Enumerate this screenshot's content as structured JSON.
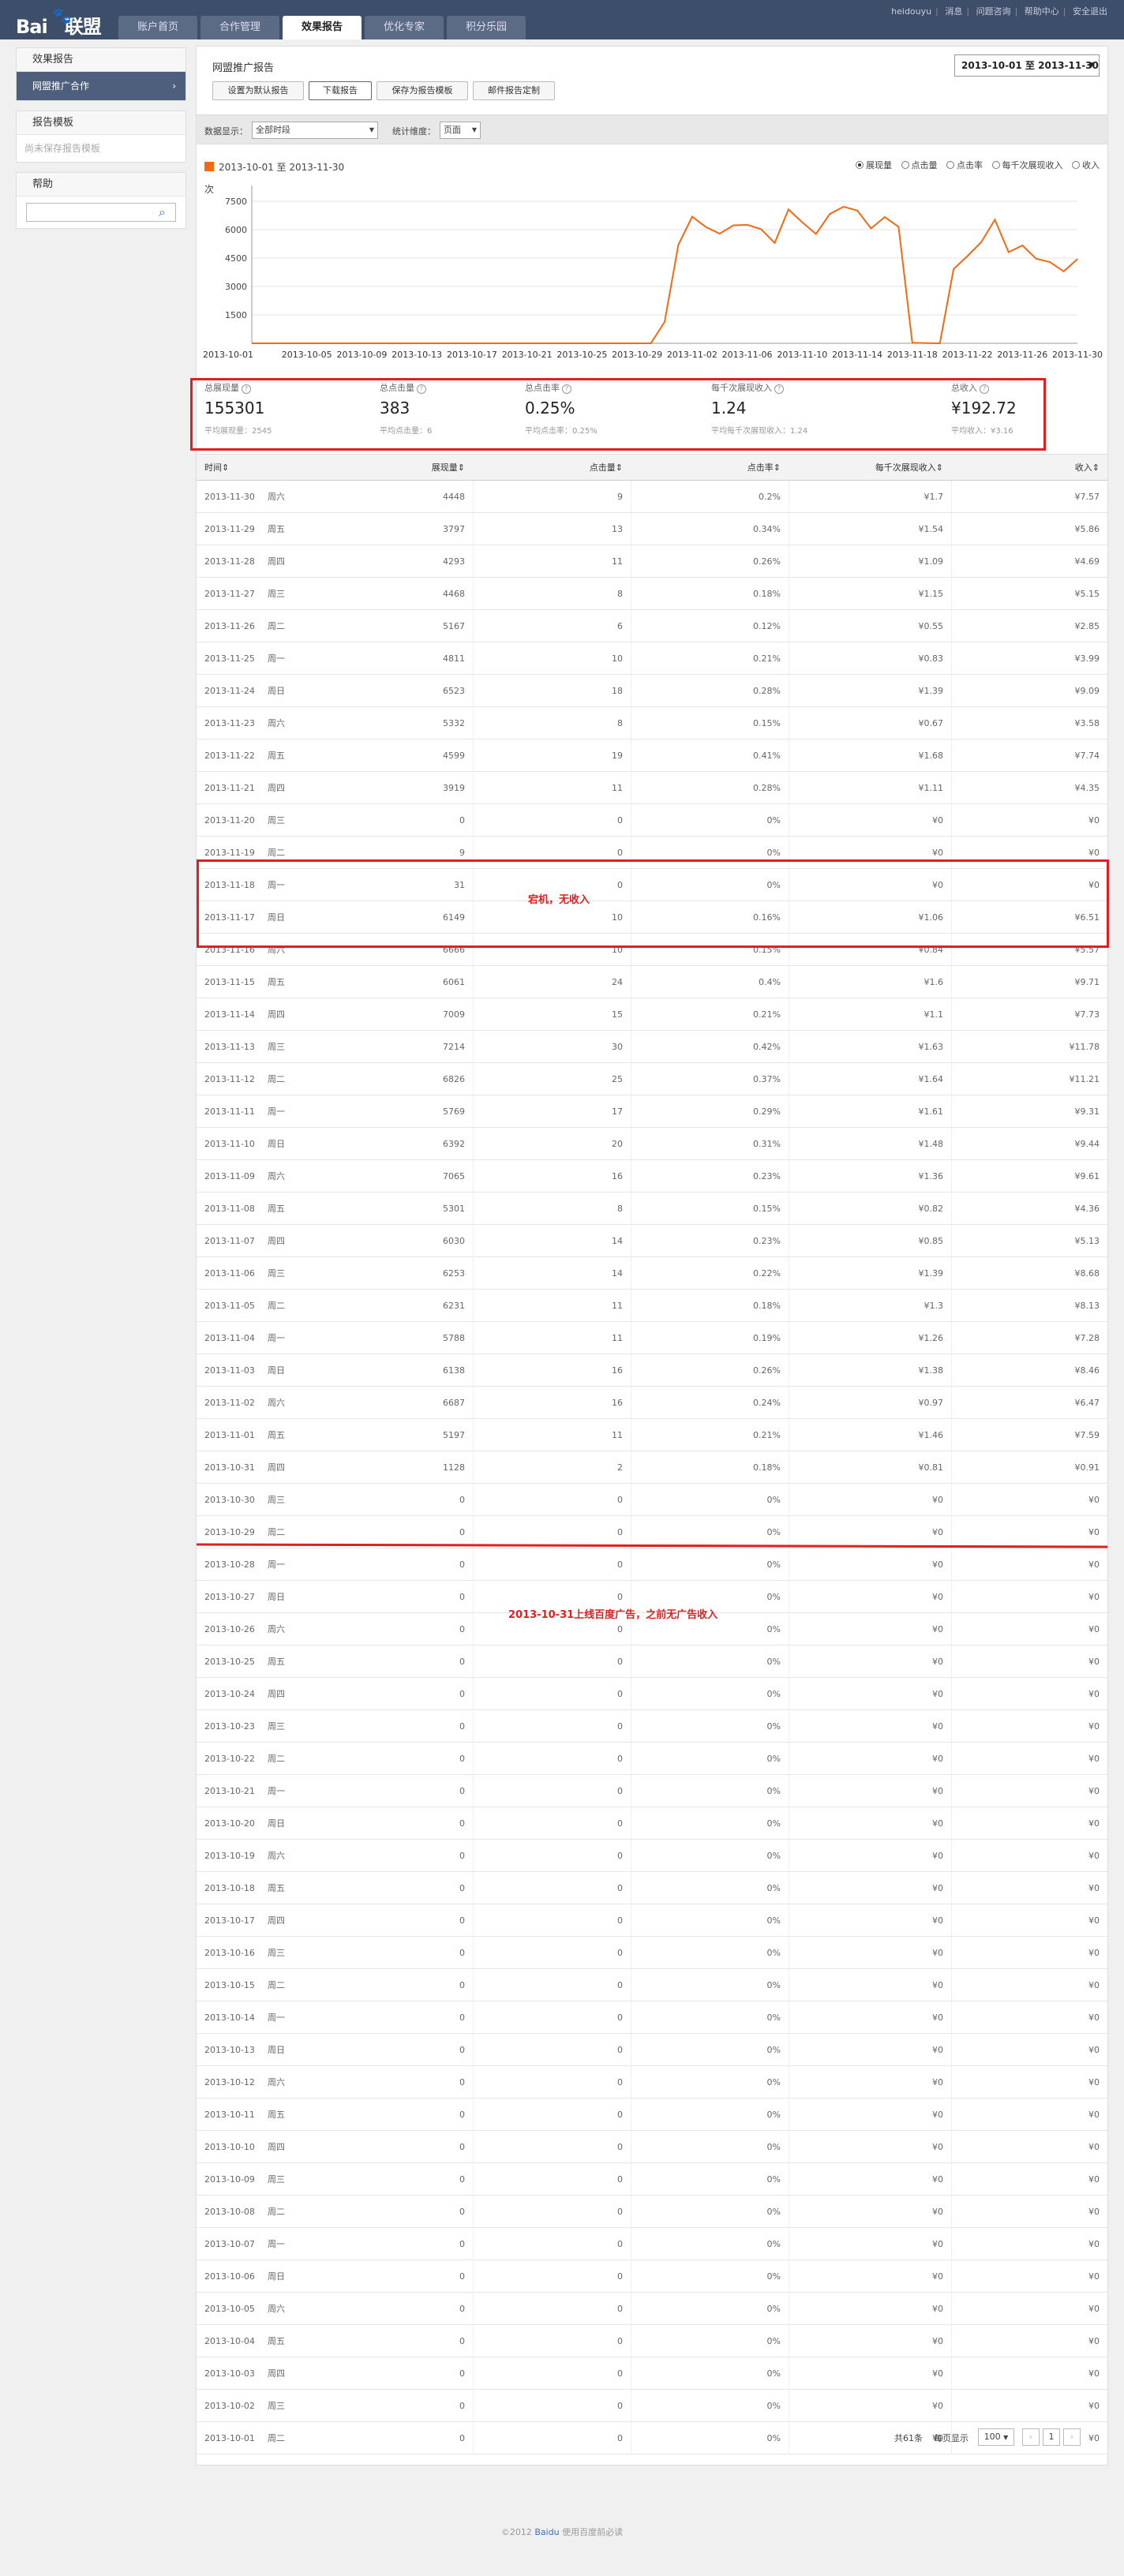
{
  "logo": {
    "text": "Bai",
    "paw": "🐾",
    "suffix": "联盟"
  },
  "nav": [
    "账户首页",
    "合作管理",
    "效果报告",
    "优化专家",
    "积分乐园"
  ],
  "toplinks": {
    "user": "heidouyu",
    "links": [
      "消息",
      "问题咨询",
      "帮助中心",
      "安全退出"
    ]
  },
  "sidebar": {
    "effect_title": "效果报告",
    "effect_item": "网盟推广合作",
    "effect_arrow": "›",
    "template_title": "报告模板",
    "template_empty": "尚未保存报告模板",
    "help_title": "帮助"
  },
  "report": {
    "title": "网盟推广报告",
    "buttons": [
      "设置为默认报告",
      "下载报告",
      "保存为报告模板",
      "邮件报告定制"
    ],
    "date_range": "2013-10-01 至 2013-11-30",
    "filter_label": "数据显示：",
    "filter_value": "全部时段",
    "dim_label": "统计维度：",
    "dim_value": "页面"
  },
  "chart_legend": "2013-10-01 至 2013-11-30",
  "metric_radios": [
    {
      "label": "展现量",
      "checked": true
    },
    {
      "label": "点击量",
      "checked": false
    },
    {
      "label": "点击率",
      "checked": false
    },
    {
      "label": "每千次展现收入",
      "checked": false
    },
    {
      "label": "收入",
      "checked": false
    }
  ],
  "chart_data": {
    "type": "line",
    "ylabel": "次",
    "ylim": [
      0,
      8000
    ],
    "yticks": [
      1500,
      3000,
      4500,
      6000,
      7500
    ],
    "xtick_labels": [
      "2013-10-01",
      "2013-10-05",
      "2013-10-09",
      "2013-10-13",
      "2013-10-17",
      "2013-10-21",
      "2013-10-25",
      "2013-10-29",
      "2013-11-02",
      "2013-11-06",
      "2013-11-10",
      "2013-11-14",
      "2013-11-18",
      "2013-11-22",
      "2013-11-26",
      "2013-11-30"
    ],
    "color": "#f26b13",
    "x": [
      "2013-10-01",
      "2013-10-02",
      "2013-10-03",
      "2013-10-04",
      "2013-10-05",
      "2013-10-06",
      "2013-10-07",
      "2013-10-08",
      "2013-10-09",
      "2013-10-10",
      "2013-10-11",
      "2013-10-12",
      "2013-10-13",
      "2013-10-14",
      "2013-10-15",
      "2013-10-16",
      "2013-10-17",
      "2013-10-18",
      "2013-10-19",
      "2013-10-20",
      "2013-10-21",
      "2013-10-22",
      "2013-10-23",
      "2013-10-24",
      "2013-10-25",
      "2013-10-26",
      "2013-10-27",
      "2013-10-28",
      "2013-10-29",
      "2013-10-30",
      "2013-10-31",
      "2013-11-01",
      "2013-11-02",
      "2013-11-03",
      "2013-11-04",
      "2013-11-05",
      "2013-11-06",
      "2013-11-07",
      "2013-11-08",
      "2013-11-09",
      "2013-11-10",
      "2013-11-11",
      "2013-11-12",
      "2013-11-13",
      "2013-11-14",
      "2013-11-15",
      "2013-11-16",
      "2013-11-17",
      "2013-11-18",
      "2013-11-19",
      "2013-11-20",
      "2013-11-21",
      "2013-11-22",
      "2013-11-23",
      "2013-11-24",
      "2013-11-25",
      "2013-11-26",
      "2013-11-27",
      "2013-11-28",
      "2013-11-29",
      "2013-11-30"
    ],
    "values": [
      0,
      0,
      0,
      0,
      0,
      0,
      0,
      0,
      0,
      0,
      0,
      0,
      0,
      0,
      0,
      0,
      0,
      0,
      0,
      0,
      0,
      0,
      0,
      0,
      0,
      0,
      0,
      0,
      0,
      0,
      1128,
      5197,
      6687,
      6138,
      5788,
      6231,
      6253,
      6030,
      5301,
      7065,
      6392,
      5769,
      6826,
      7214,
      7009,
      6061,
      6666,
      6149,
      31,
      9,
      0,
      3919,
      4599,
      5332,
      6523,
      4811,
      5167,
      4468,
      4293,
      3797,
      4448
    ]
  },
  "summary": [
    {
      "label": "总展现量",
      "value": "155301",
      "avg_label": "平均展现量：",
      "avg": "2545"
    },
    {
      "label": "总点击量",
      "value": "383",
      "avg_label": "平均点击量：",
      "avg": "6"
    },
    {
      "label": "总点击率",
      "value": "0.25%",
      "avg_label": "平均点击率：",
      "avg": "0.25%"
    },
    {
      "label": "每千次展现收入",
      "value": "1.24",
      "avg_label": "平均每千次展现收入：",
      "avg": "1.24"
    },
    {
      "label": "总收入",
      "value": "¥192.72",
      "avg_label": "平均收入：",
      "avg": "¥3.16"
    }
  ],
  "summary_q": "?",
  "table": {
    "headers": [
      "时间",
      "展现量",
      "点击量",
      "点击率",
      "每千次展现收入",
      "收入"
    ],
    "sort_icon": "⇕",
    "rows": [
      [
        "2013-11-30",
        "周六",
        "4448",
        "9",
        "0.2%",
        "¥1.7",
        "¥7.57"
      ],
      [
        "2013-11-29",
        "周五",
        "3797",
        "13",
        "0.34%",
        "¥1.54",
        "¥5.86"
      ],
      [
        "2013-11-28",
        "周四",
        "4293",
        "11",
        "0.26%",
        "¥1.09",
        "¥4.69"
      ],
      [
        "2013-11-27",
        "周三",
        "4468",
        "8",
        "0.18%",
        "¥1.15",
        "¥5.15"
      ],
      [
        "2013-11-26",
        "周二",
        "5167",
        "6",
        "0.12%",
        "¥0.55",
        "¥2.85"
      ],
      [
        "2013-11-25",
        "周一",
        "4811",
        "10",
        "0.21%",
        "¥0.83",
        "¥3.99"
      ],
      [
        "2013-11-24",
        "周日",
        "6523",
        "18",
        "0.28%",
        "¥1.39",
        "¥9.09"
      ],
      [
        "2013-11-23",
        "周六",
        "5332",
        "8",
        "0.15%",
        "¥0.67",
        "¥3.58"
      ],
      [
        "2013-11-22",
        "周五",
        "4599",
        "19",
        "0.41%",
        "¥1.68",
        "¥7.74"
      ],
      [
        "2013-11-21",
        "周四",
        "3919",
        "11",
        "0.28%",
        "¥1.11",
        "¥4.35"
      ],
      [
        "2013-11-20",
        "周三",
        "0",
        "0",
        "0%",
        "¥0",
        "¥0"
      ],
      [
        "2013-11-19",
        "周二",
        "9",
        "0",
        "0%",
        "¥0",
        "¥0"
      ],
      [
        "2013-11-18",
        "周一",
        "31",
        "0",
        "0%",
        "¥0",
        "¥0"
      ],
      [
        "2013-11-17",
        "周日",
        "6149",
        "10",
        "0.16%",
        "¥1.06",
        "¥6.51"
      ],
      [
        "2013-11-16",
        "周六",
        "6666",
        "10",
        "0.15%",
        "¥0.84",
        "¥5.57"
      ],
      [
        "2013-11-15",
        "周五",
        "6061",
        "24",
        "0.4%",
        "¥1.6",
        "¥9.71"
      ],
      [
        "2013-11-14",
        "周四",
        "7009",
        "15",
        "0.21%",
        "¥1.1",
        "¥7.73"
      ],
      [
        "2013-11-13",
        "周三",
        "7214",
        "30",
        "0.42%",
        "¥1.63",
        "¥11.78"
      ],
      [
        "2013-11-12",
        "周二",
        "6826",
        "25",
        "0.37%",
        "¥1.64",
        "¥11.21"
      ],
      [
        "2013-11-11",
        "周一",
        "5769",
        "17",
        "0.29%",
        "¥1.61",
        "¥9.31"
      ],
      [
        "2013-11-10",
        "周日",
        "6392",
        "20",
        "0.31%",
        "¥1.48",
        "¥9.44"
      ],
      [
        "2013-11-09",
        "周六",
        "7065",
        "16",
        "0.23%",
        "¥1.36",
        "¥9.61"
      ],
      [
        "2013-11-08",
        "周五",
        "5301",
        "8",
        "0.15%",
        "¥0.82",
        "¥4.36"
      ],
      [
        "2013-11-07",
        "周四",
        "6030",
        "14",
        "0.23%",
        "¥0.85",
        "¥5.13"
      ],
      [
        "2013-11-06",
        "周三",
        "6253",
        "14",
        "0.22%",
        "¥1.39",
        "¥8.68"
      ],
      [
        "2013-11-05",
        "周二",
        "6231",
        "11",
        "0.18%",
        "¥1.3",
        "¥8.13"
      ],
      [
        "2013-11-04",
        "周一",
        "5788",
        "11",
        "0.19%",
        "¥1.26",
        "¥7.28"
      ],
      [
        "2013-11-03",
        "周日",
        "6138",
        "16",
        "0.26%",
        "¥1.38",
        "¥8.46"
      ],
      [
        "2013-11-02",
        "周六",
        "6687",
        "16",
        "0.24%",
        "¥0.97",
        "¥6.47"
      ],
      [
        "2013-11-01",
        "周五",
        "5197",
        "11",
        "0.21%",
        "¥1.46",
        "¥7.59"
      ],
      [
        "2013-10-31",
        "周四",
        "1128",
        "2",
        "0.18%",
        "¥0.81",
        "¥0.91"
      ],
      [
        "2013-10-30",
        "周三",
        "0",
        "0",
        "0%",
        "¥0",
        "¥0"
      ],
      [
        "2013-10-29",
        "周二",
        "0",
        "0",
        "0%",
        "¥0",
        "¥0"
      ],
      [
        "2013-10-28",
        "周一",
        "0",
        "0",
        "0%",
        "¥0",
        "¥0"
      ],
      [
        "2013-10-27",
        "周日",
        "0",
        "0",
        "0%",
        "¥0",
        "¥0"
      ],
      [
        "2013-10-26",
        "周六",
        "0",
        "0",
        "0%",
        "¥0",
        "¥0"
      ],
      [
        "2013-10-25",
        "周五",
        "0",
        "0",
        "0%",
        "¥0",
        "¥0"
      ],
      [
        "2013-10-24",
        "周四",
        "0",
        "0",
        "0%",
        "¥0",
        "¥0"
      ],
      [
        "2013-10-23",
        "周三",
        "0",
        "0",
        "0%",
        "¥0",
        "¥0"
      ],
      [
        "2013-10-22",
        "周二",
        "0",
        "0",
        "0%",
        "¥0",
        "¥0"
      ],
      [
        "2013-10-21",
        "周一",
        "0",
        "0",
        "0%",
        "¥0",
        "¥0"
      ],
      [
        "2013-10-20",
        "周日",
        "0",
        "0",
        "0%",
        "¥0",
        "¥0"
      ],
      [
        "2013-10-19",
        "周六",
        "0",
        "0",
        "0%",
        "¥0",
        "¥0"
      ],
      [
        "2013-10-18",
        "周五",
        "0",
        "0",
        "0%",
        "¥0",
        "¥0"
      ],
      [
        "2013-10-17",
        "周四",
        "0",
        "0",
        "0%",
        "¥0",
        "¥0"
      ],
      [
        "2013-10-16",
        "周三",
        "0",
        "0",
        "0%",
        "¥0",
        "¥0"
      ],
      [
        "2013-10-15",
        "周二",
        "0",
        "0",
        "0%",
        "¥0",
        "¥0"
      ],
      [
        "2013-10-14",
        "周一",
        "0",
        "0",
        "0%",
        "¥0",
        "¥0"
      ],
      [
        "2013-10-13",
        "周日",
        "0",
        "0",
        "0%",
        "¥0",
        "¥0"
      ],
      [
        "2013-10-12",
        "周六",
        "0",
        "0",
        "0%",
        "¥0",
        "¥0"
      ],
      [
        "2013-10-11",
        "周五",
        "0",
        "0",
        "0%",
        "¥0",
        "¥0"
      ],
      [
        "2013-10-10",
        "周四",
        "0",
        "0",
        "0%",
        "¥0",
        "¥0"
      ],
      [
        "2013-10-09",
        "周三",
        "0",
        "0",
        "0%",
        "¥0",
        "¥0"
      ],
      [
        "2013-10-08",
        "周二",
        "0",
        "0",
        "0%",
        "¥0",
        "¥0"
      ],
      [
        "2013-10-07",
        "周一",
        "0",
        "0",
        "0%",
        "¥0",
        "¥0"
      ],
      [
        "2013-10-06",
        "周日",
        "0",
        "0",
        "0%",
        "¥0",
        "¥0"
      ],
      [
        "2013-10-05",
        "周六",
        "0",
        "0",
        "0%",
        "¥0",
        "¥0"
      ],
      [
        "2013-10-04",
        "周五",
        "0",
        "0",
        "0%",
        "¥0",
        "¥0"
      ],
      [
        "2013-10-03",
        "周四",
        "0",
        "0",
        "0%",
        "¥0",
        "¥0"
      ],
      [
        "2013-10-02",
        "周三",
        "0",
        "0",
        "0%",
        "¥0",
        "¥0"
      ],
      [
        "2013-10-01",
        "周二",
        "0",
        "0",
        "0%",
        "¥0",
        "¥0"
      ]
    ]
  },
  "annotations": {
    "outage": "宕机，无收入",
    "launch": "2013-10-31上线百度广告，之前无广告收入"
  },
  "pager": {
    "total": "共61条",
    "per_page_label": "每页显示",
    "per_page": "100",
    "page": "1",
    "prev": "‹",
    "next": "›"
  },
  "footer": {
    "copy": "©2012 ",
    "brand": "Baidu",
    "rest": " 使用百度前必读"
  },
  "colors": {
    "topbar": "#3d4e6a",
    "line": "#f26b13",
    "annotation": "#e02020"
  }
}
